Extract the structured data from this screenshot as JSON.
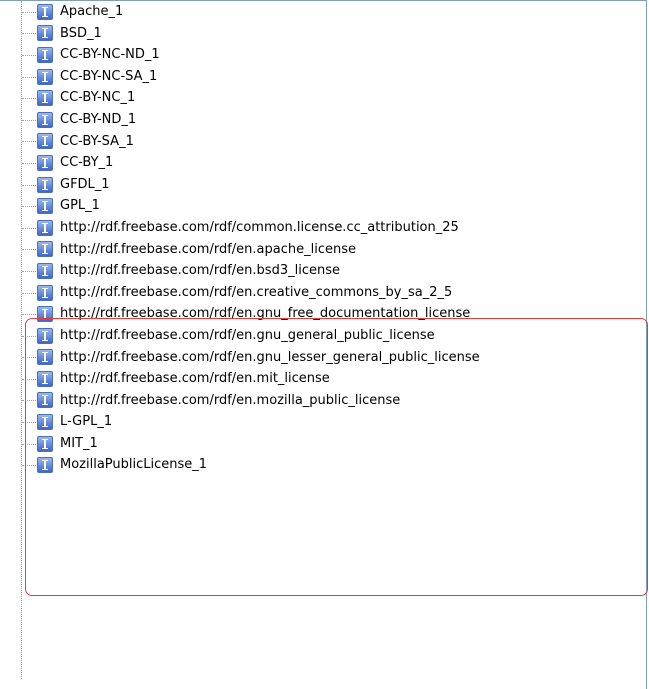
{
  "tree": {
    "items": [
      {
        "label": "Apache_1"
      },
      {
        "label": "BSD_1"
      },
      {
        "label": "CC-BY-NC-ND_1"
      },
      {
        "label": "CC-BY-NC-SA_1"
      },
      {
        "label": "CC-BY-NC_1"
      },
      {
        "label": "CC-BY-ND_1"
      },
      {
        "label": "CC-BY-SA_1"
      },
      {
        "label": "CC-BY_1"
      },
      {
        "label": "GFDL_1"
      },
      {
        "label": "GPL_1"
      },
      {
        "label": "http://rdf.freebase.com/rdf/common.license.cc_attribution_25"
      },
      {
        "label": "http://rdf.freebase.com/rdf/en.apache_license"
      },
      {
        "label": "http://rdf.freebase.com/rdf/en.bsd3_license"
      },
      {
        "label": "http://rdf.freebase.com/rdf/en.creative_commons_by_sa_2_5"
      },
      {
        "label": "http://rdf.freebase.com/rdf/en.gnu_free_documentation_license"
      },
      {
        "label": "http://rdf.freebase.com/rdf/en.gnu_general_public_license"
      },
      {
        "label": "http://rdf.freebase.com/rdf/en.gnu_lesser_general_public_license"
      },
      {
        "label": "http://rdf.freebase.com/rdf/en.mit_license"
      },
      {
        "label": "http://rdf.freebase.com/rdf/en.mozilla_public_license"
      },
      {
        "label": "L-GPL_1"
      },
      {
        "label": "MIT_1"
      },
      {
        "label": "MozillaPublicLicense_1"
      }
    ]
  },
  "icon": {
    "name": "individual-icon",
    "glyph": "I"
  },
  "colors": {
    "highlight": "#e83a3a",
    "icon": "#3f66c4",
    "border": "#7f9db9"
  }
}
